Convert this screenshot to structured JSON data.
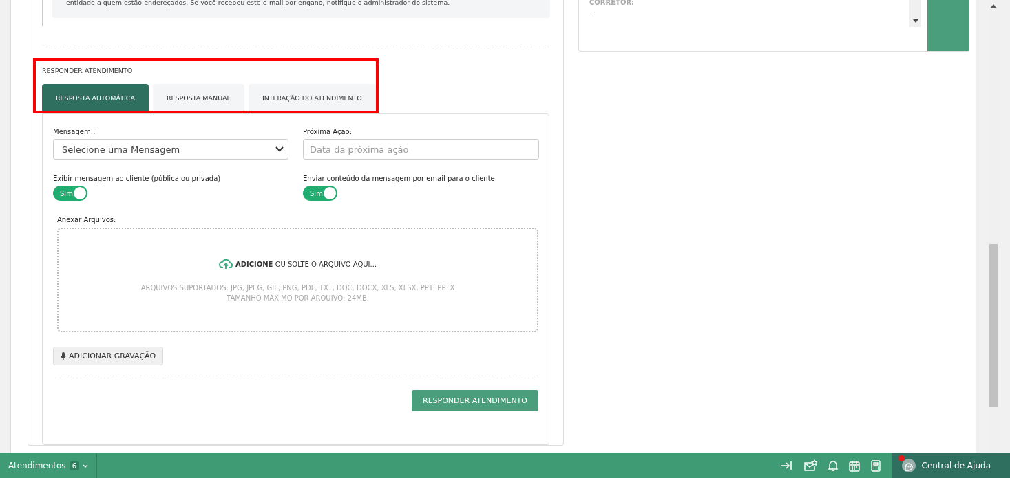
{
  "email_notice": "entidade a quem estão endereçados. Se você recebeu este e-mail por engano, notifique o administrador do sistema.",
  "side_panel": {
    "label": "CORRETOR:",
    "value": "--"
  },
  "reply": {
    "title": "RESPONDER ATENDIMENTO",
    "highlighted": true,
    "tabs": [
      {
        "label": "RESPOSTA AUTOMÁTICA",
        "selected": true
      },
      {
        "label": "RESPOSTA MANUAL",
        "selected": false
      },
      {
        "label": "INTERAÇÃO DO ATENDIMENTO",
        "selected": false
      }
    ],
    "message": {
      "label": "Mensagem::",
      "value": "Selecione uma Mensagem"
    },
    "next_action": {
      "label": "Próxima Ação:",
      "placeholder": "Data da próxima ação"
    },
    "toggles": [
      {
        "label": "Exibir mensagem ao cliente (pública ou privada)",
        "text": "Sim",
        "on": true
      },
      {
        "label": "Enviar conteúdo da mensagem por email para o cliente",
        "text": "Sim",
        "on": true
      }
    ],
    "attach": {
      "label": "Anexar Arquivos:",
      "action": "**ADICIONE** OU SOLTE O ARQUIVO AQUI...",
      "formats": "ARQUIVOS SUPORTADOS: JPG, JPEG, GIF, PNG, PDF, TXT, DOC, DOCX, XLS, XLSX, PPT, PPTX",
      "max_size": "TAMANHO MÁXIMO POR ARQUIVO: 24MB."
    },
    "record_button": "ADICIONAR GRAVAÇÃO",
    "submit_button": "RESPONDER ATENDIMENTO"
  },
  "bottom_bar": {
    "atendimentos": "Atendimentos",
    "count": "6",
    "help": "Central de Ajuda",
    "help_alert": true
  }
}
